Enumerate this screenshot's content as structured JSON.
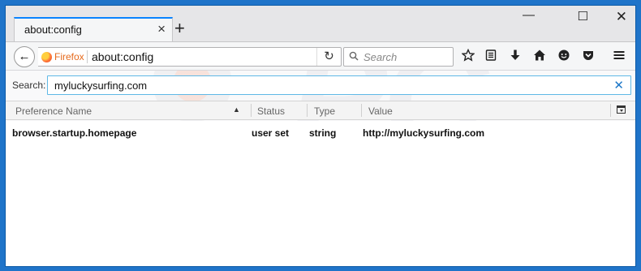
{
  "tab": {
    "title": "about:config",
    "close": "×",
    "new": "+"
  },
  "window_controls": {
    "minimize": "—",
    "maximize": "☐",
    "close": "✕"
  },
  "nav": {
    "back": "←",
    "identity": "Firefox",
    "url": "about:config",
    "reload": "↻",
    "search_placeholder": "Search"
  },
  "toolbar_icons": [
    "star-icon",
    "reading-list-icon",
    "download-icon",
    "home-icon",
    "chat-icon",
    "pocket-icon",
    "menu-icon"
  ],
  "filter": {
    "label": "Search:",
    "value": "myluckysurfing.com",
    "clear": "✕"
  },
  "table": {
    "columns": [
      "Preference Name",
      "Status",
      "Type",
      "Value"
    ],
    "sort_indicator": "▲",
    "rows": [
      {
        "name": "browser.startup.homepage",
        "status": "user set",
        "type": "string",
        "value": "http://myluckysurfing.com"
      }
    ]
  },
  "colors": {
    "accent": "#0a84ff",
    "frame": "#1f74c9",
    "filter_border": "#5fb8e6",
    "clear_icon": "#1e78c8"
  }
}
